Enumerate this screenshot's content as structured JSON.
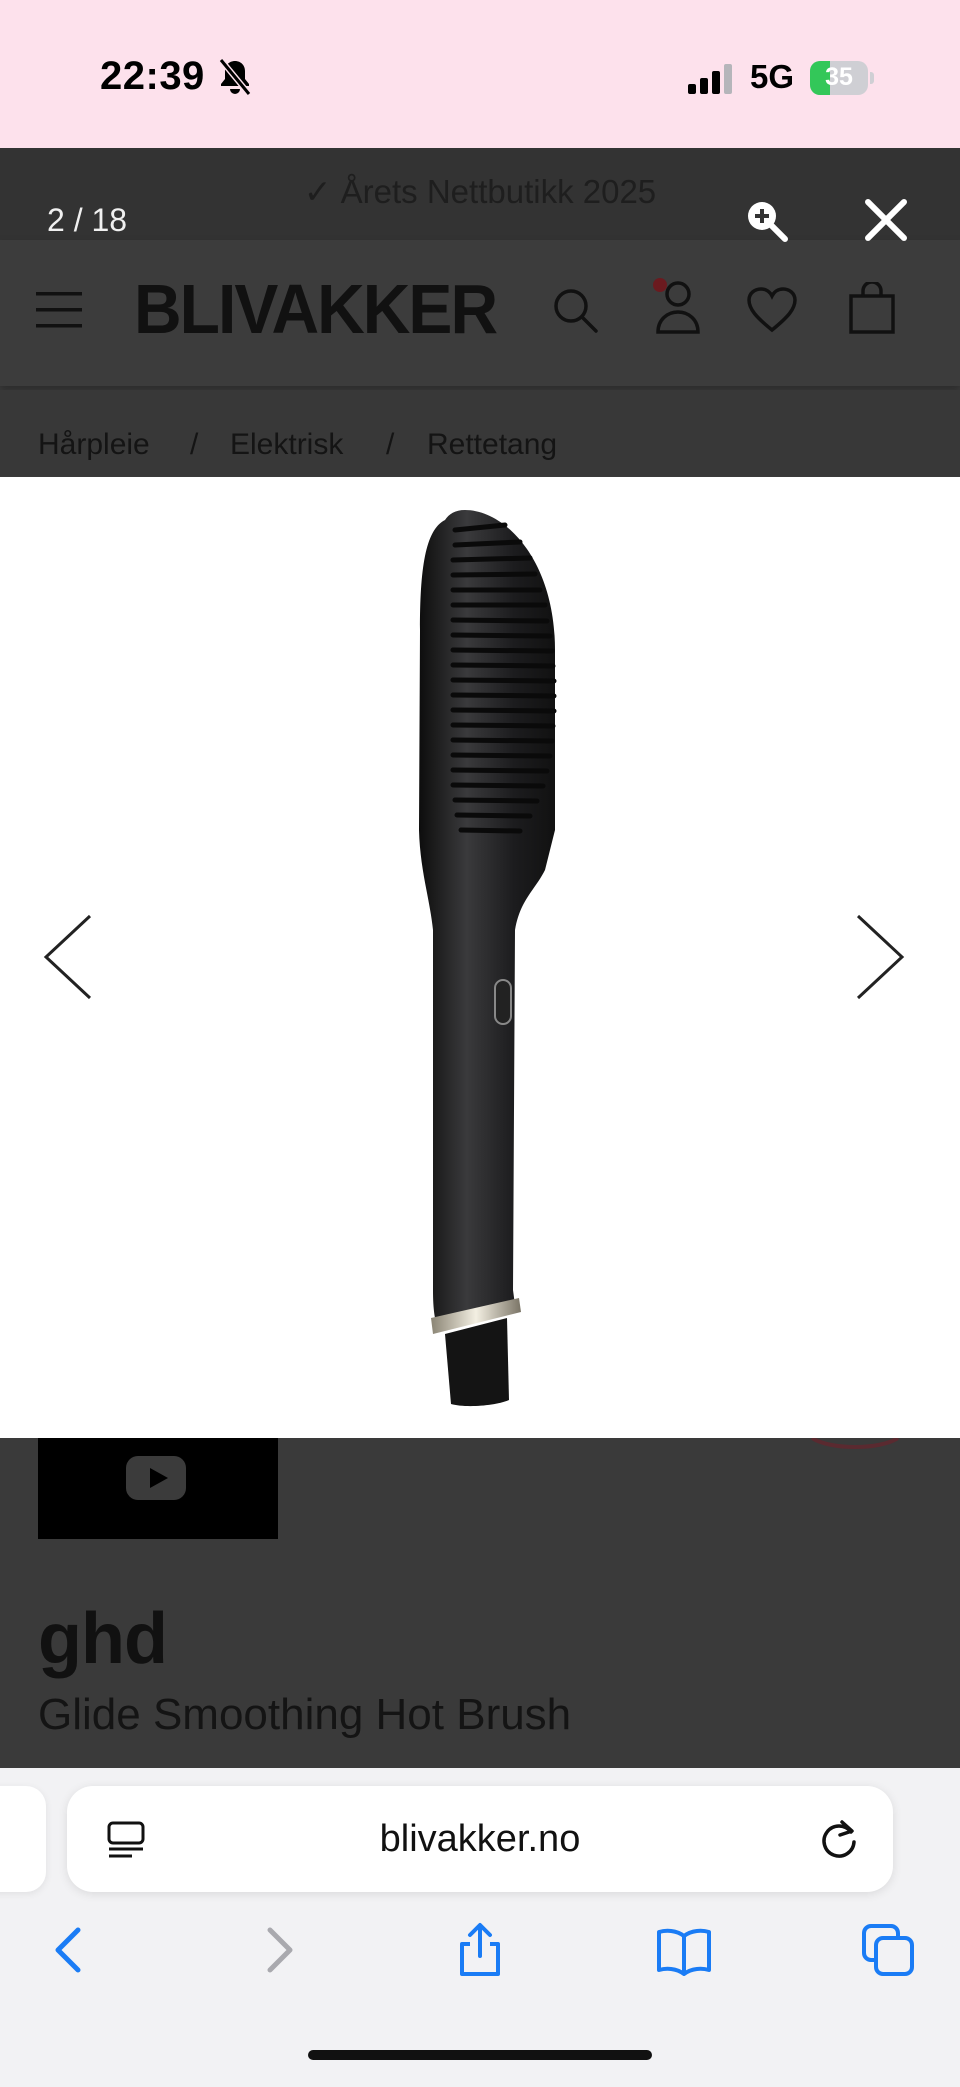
{
  "status_bar": {
    "time": "22:39",
    "network": "5G",
    "battery_percent": 35,
    "battery_label": "35"
  },
  "promo": {
    "text": "✓ Årets Nettbutikk 2025"
  },
  "header": {
    "logo": "BLIVAKKER"
  },
  "breadcrumb": {
    "items": [
      "Hårpleie",
      "Elektrisk",
      "Rettetang"
    ],
    "separator": "/"
  },
  "lightbox": {
    "counter": "2 / 18"
  },
  "product": {
    "brand": "ghd",
    "name": "Glide Smoothing Hot Brush"
  },
  "browser": {
    "url": "blivakker.no"
  },
  "colors": {
    "status_bar_bg": "#fde1ec",
    "overlay_bg": "#3a3a3a",
    "safari_blue": "#1a7cf5",
    "battery_green": "#33c759"
  }
}
